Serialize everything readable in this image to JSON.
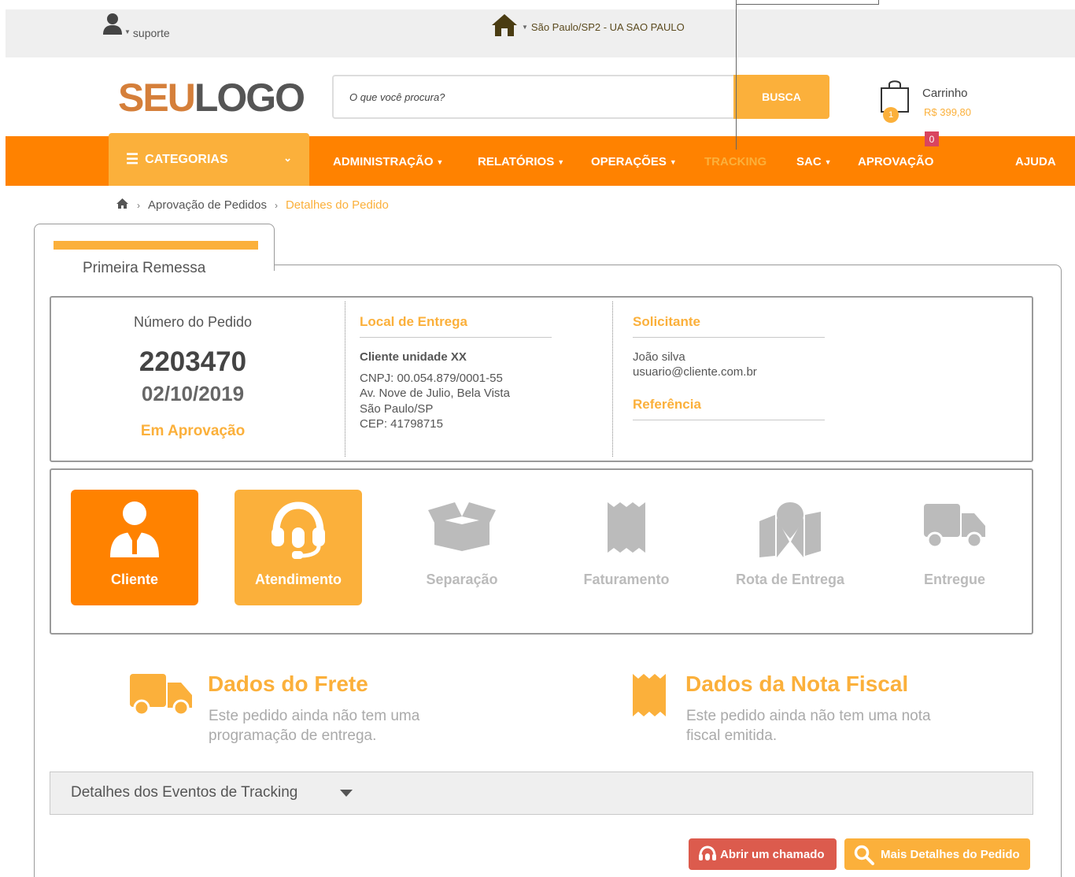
{
  "topbar": {
    "user_name": "suporte",
    "location": "São Paulo/SP2 - UA SAO PAULO"
  },
  "header": {
    "logo_part1": "SEU",
    "logo_part2": "LOGO",
    "search_placeholder": "O que você procura?",
    "search_button": "BUSCA",
    "cart_title": "Carrinho",
    "cart_total": "R$ 399,80",
    "cart_count": "1"
  },
  "nav": {
    "categories": "CATEGORIAS",
    "items": [
      {
        "label": "ADMINISTRAÇÃO"
      },
      {
        "label": "RELATÓRIOS"
      },
      {
        "label": "OPERAÇÕES"
      },
      {
        "label": "TRACKING"
      },
      {
        "label": "SAC"
      },
      {
        "label": "APROVAÇÃO"
      },
      {
        "label": "AJUDA"
      }
    ],
    "approval_count": "0"
  },
  "breadcrumb": {
    "items": [
      "Aprovação de Pedidos",
      "Detalhes do Pedido"
    ]
  },
  "card": {
    "tab_label": "Primeira Remessa",
    "order": {
      "label": "Número do Pedido",
      "number": "2203470",
      "date": "02/10/2019",
      "status": "Em Aprovação"
    },
    "delivery": {
      "title": "Local de Entrega",
      "name": "Cliente unidade XX",
      "cnpj": "CNPJ: 00.054.879/0001-55",
      "address": "Av. Nove de Julio, Bela Vista",
      "city": "São Paulo/SP",
      "cep": "CEP: 41798715"
    },
    "requester": {
      "title": "Solicitante",
      "name": "João silva",
      "email": "usuario@cliente.com.br",
      "reference_title": "Referência"
    },
    "steps": [
      {
        "label": "Cliente",
        "state": "done"
      },
      {
        "label": "Atendimento",
        "state": "active"
      },
      {
        "label": "Separação",
        "state": "pending"
      },
      {
        "label": "Faturamento",
        "state": "pending"
      },
      {
        "label": "Rota de Entrega",
        "state": "pending"
      },
      {
        "label": "Entregue",
        "state": "pending"
      }
    ],
    "freight": {
      "title": "Dados do Frete",
      "text": "Este pedido ainda não tem uma programação de entrega."
    },
    "invoice": {
      "title": "Dados da Nota Fiscal",
      "text": "Este pedido ainda não tem uma nota fiscal emitida."
    },
    "tracking_details": "Detalhes dos Eventos de Tracking",
    "buttons": {
      "open_ticket": "Abrir um chamado",
      "more_details": "Mais Detalhes do Pedido"
    }
  },
  "colors": {
    "primary_orange": "#ff8200",
    "accent_yellow": "#fbb03b",
    "danger_red": "#dc5b4d",
    "badge_pink": "#d9455f"
  }
}
